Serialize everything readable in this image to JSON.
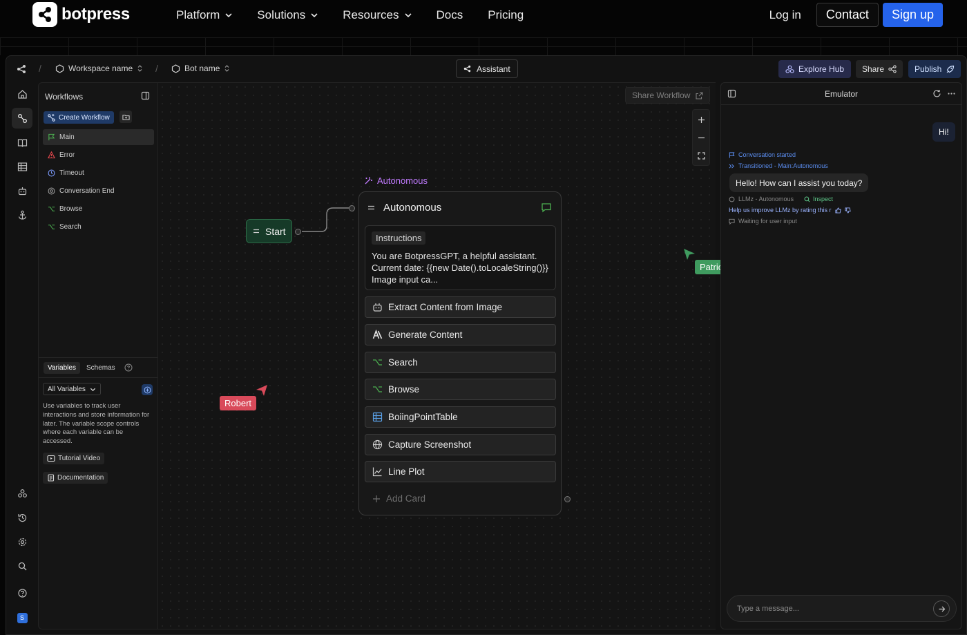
{
  "site": {
    "brand": "botpress",
    "nav": [
      {
        "label": "Platform",
        "has_menu": true
      },
      {
        "label": "Solutions",
        "has_menu": true
      },
      {
        "label": "Resources",
        "has_menu": true
      },
      {
        "label": "Docs",
        "has_menu": false
      },
      {
        "label": "Pricing",
        "has_menu": false
      }
    ],
    "login": "Log in",
    "contact": "Contact",
    "signup": "Sign up",
    "signup_color": "#2563eb"
  },
  "appbar": {
    "workspace": "Workspace name",
    "bot": "Bot name",
    "assistant": "Assistant",
    "explore_hub": "Explore Hub",
    "share": "Share",
    "publish": "Publish"
  },
  "workflows": {
    "title": "Workflows",
    "create": "Create Workflow",
    "items": [
      {
        "label": "Main",
        "icon": "flag-icon",
        "color": "#4caf50"
      },
      {
        "label": "Error",
        "icon": "warning-icon",
        "color": "#e5484d"
      },
      {
        "label": "Timeout",
        "icon": "clock-icon",
        "color": "#7c9cff"
      },
      {
        "label": "Conversation End",
        "icon": "target-icon",
        "color": "#9a9a9a"
      },
      {
        "label": "Browse",
        "icon": "branch-icon",
        "color": "#4caf50"
      },
      {
        "label": "Search",
        "icon": "branch-icon",
        "color": "#4caf50"
      }
    ],
    "tabs": {
      "variables": "Variables",
      "schemas": "Schemas"
    },
    "all_variables": "All Variables",
    "description": "Use variables to track user interactions and store information for later. The variable scope controls where each variable can be accessed.",
    "tutorial": "Tutorial Video",
    "documentation": "Documentation"
  },
  "canvas": {
    "share_workflow": "Share Workflow",
    "start": "Start",
    "node_tag": "Autonomous",
    "node_title": "Autonomous",
    "instructions_tag": "Instructions",
    "instructions_text": "You are BotpressGPT, a helpful assistant. Current date: {{new Date().toLocaleString()}} Image input ca...",
    "cards": [
      {
        "label": "Extract Content from Image",
        "icon": "robot-icon"
      },
      {
        "label": "Generate Content",
        "icon": "anthropic-icon"
      },
      {
        "label": "Search",
        "icon": "branch-icon"
      },
      {
        "label": "Browse",
        "icon": "branch-icon"
      },
      {
        "label": "BoiingPointTable",
        "icon": "table-icon"
      },
      {
        "label": "Capture Screenshot",
        "icon": "globe-icon"
      },
      {
        "label": "Line Plot",
        "icon": "line-chart-icon"
      }
    ],
    "add_card": "Add Card",
    "cursors": [
      {
        "name": "Patrick",
        "color": "#3f9b5f"
      },
      {
        "name": "Robert",
        "color": "#d94a5a"
      }
    ]
  },
  "emulator": {
    "title": "Emulator",
    "user_message": "Hi!",
    "events": [
      {
        "text": "Conversation started",
        "color": "#5b8def"
      },
      {
        "text": "Transitioned - Main:Autonomous",
        "color": "#5b8def"
      }
    ],
    "bot_message": "Hello! How can I assist you today?",
    "llm_status": "LLMz - Autonomous",
    "inspect": "Inspect",
    "rating_prompt": "Help us improve LLMz by rating this r",
    "waiting": "Waiting for user input",
    "input_placeholder": "Type a message..."
  }
}
